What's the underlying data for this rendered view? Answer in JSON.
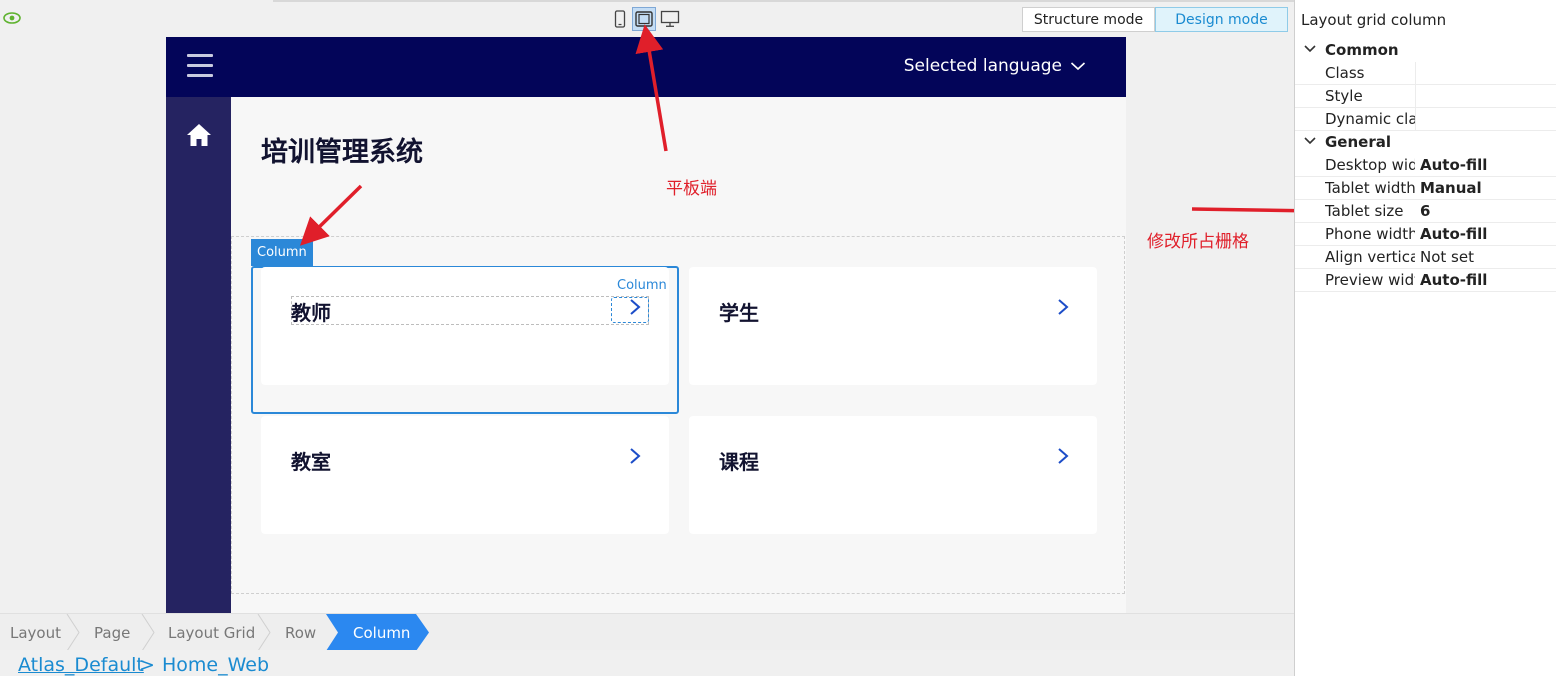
{
  "toolbar": {
    "device_buttons": [
      {
        "name": "phone",
        "active": false
      },
      {
        "name": "tablet",
        "active": true
      },
      {
        "name": "desktop",
        "active": false
      }
    ],
    "structure_mode": "Structure mode",
    "design_mode": "Design mode"
  },
  "app": {
    "language_label": "Selected language",
    "page_title": "培训管理系统",
    "cards": [
      {
        "title": "教师"
      },
      {
        "title": "学生"
      },
      {
        "title": "教室"
      },
      {
        "title": "课程"
      }
    ],
    "column_tag": "Column",
    "inner_column_tag": "Column"
  },
  "annotations": {
    "tablet_note": "平板端",
    "grid_note": "修改所占栅格"
  },
  "breadcrumb": {
    "items": [
      "Layout",
      "Page",
      "Layout Grid",
      "Row",
      "Column"
    ],
    "active_index": 4
  },
  "pathbar": {
    "project": "Atlas_Default",
    "separator": ">",
    "page": "Home_Web"
  },
  "properties": {
    "title": "Layout grid column",
    "sections": [
      {
        "label": "Common",
        "rows": [
          {
            "key": "Class",
            "value": ""
          },
          {
            "key": "Style",
            "value": ""
          },
          {
            "key": "Dynamic clas",
            "value": ""
          }
        ]
      },
      {
        "label": "General",
        "rows": [
          {
            "key": "Desktop widt",
            "value": "Auto-fill",
            "bold": true
          },
          {
            "key": "Tablet width",
            "value": "Manual",
            "bold": true
          },
          {
            "key": "Tablet size",
            "value": "6",
            "bold": true
          },
          {
            "key": "Phone width",
            "value": "Auto-fill",
            "bold": true
          },
          {
            "key": "Align vertical",
            "value": "Not set",
            "bold": false
          },
          {
            "key": "Preview width",
            "value": "Auto-fill",
            "bold": true
          }
        ]
      }
    ]
  },
  "colors": {
    "navbar": "#030559",
    "sidebar": "#252361",
    "accent": "#2b88d8",
    "annotation": "#e01f2a"
  }
}
